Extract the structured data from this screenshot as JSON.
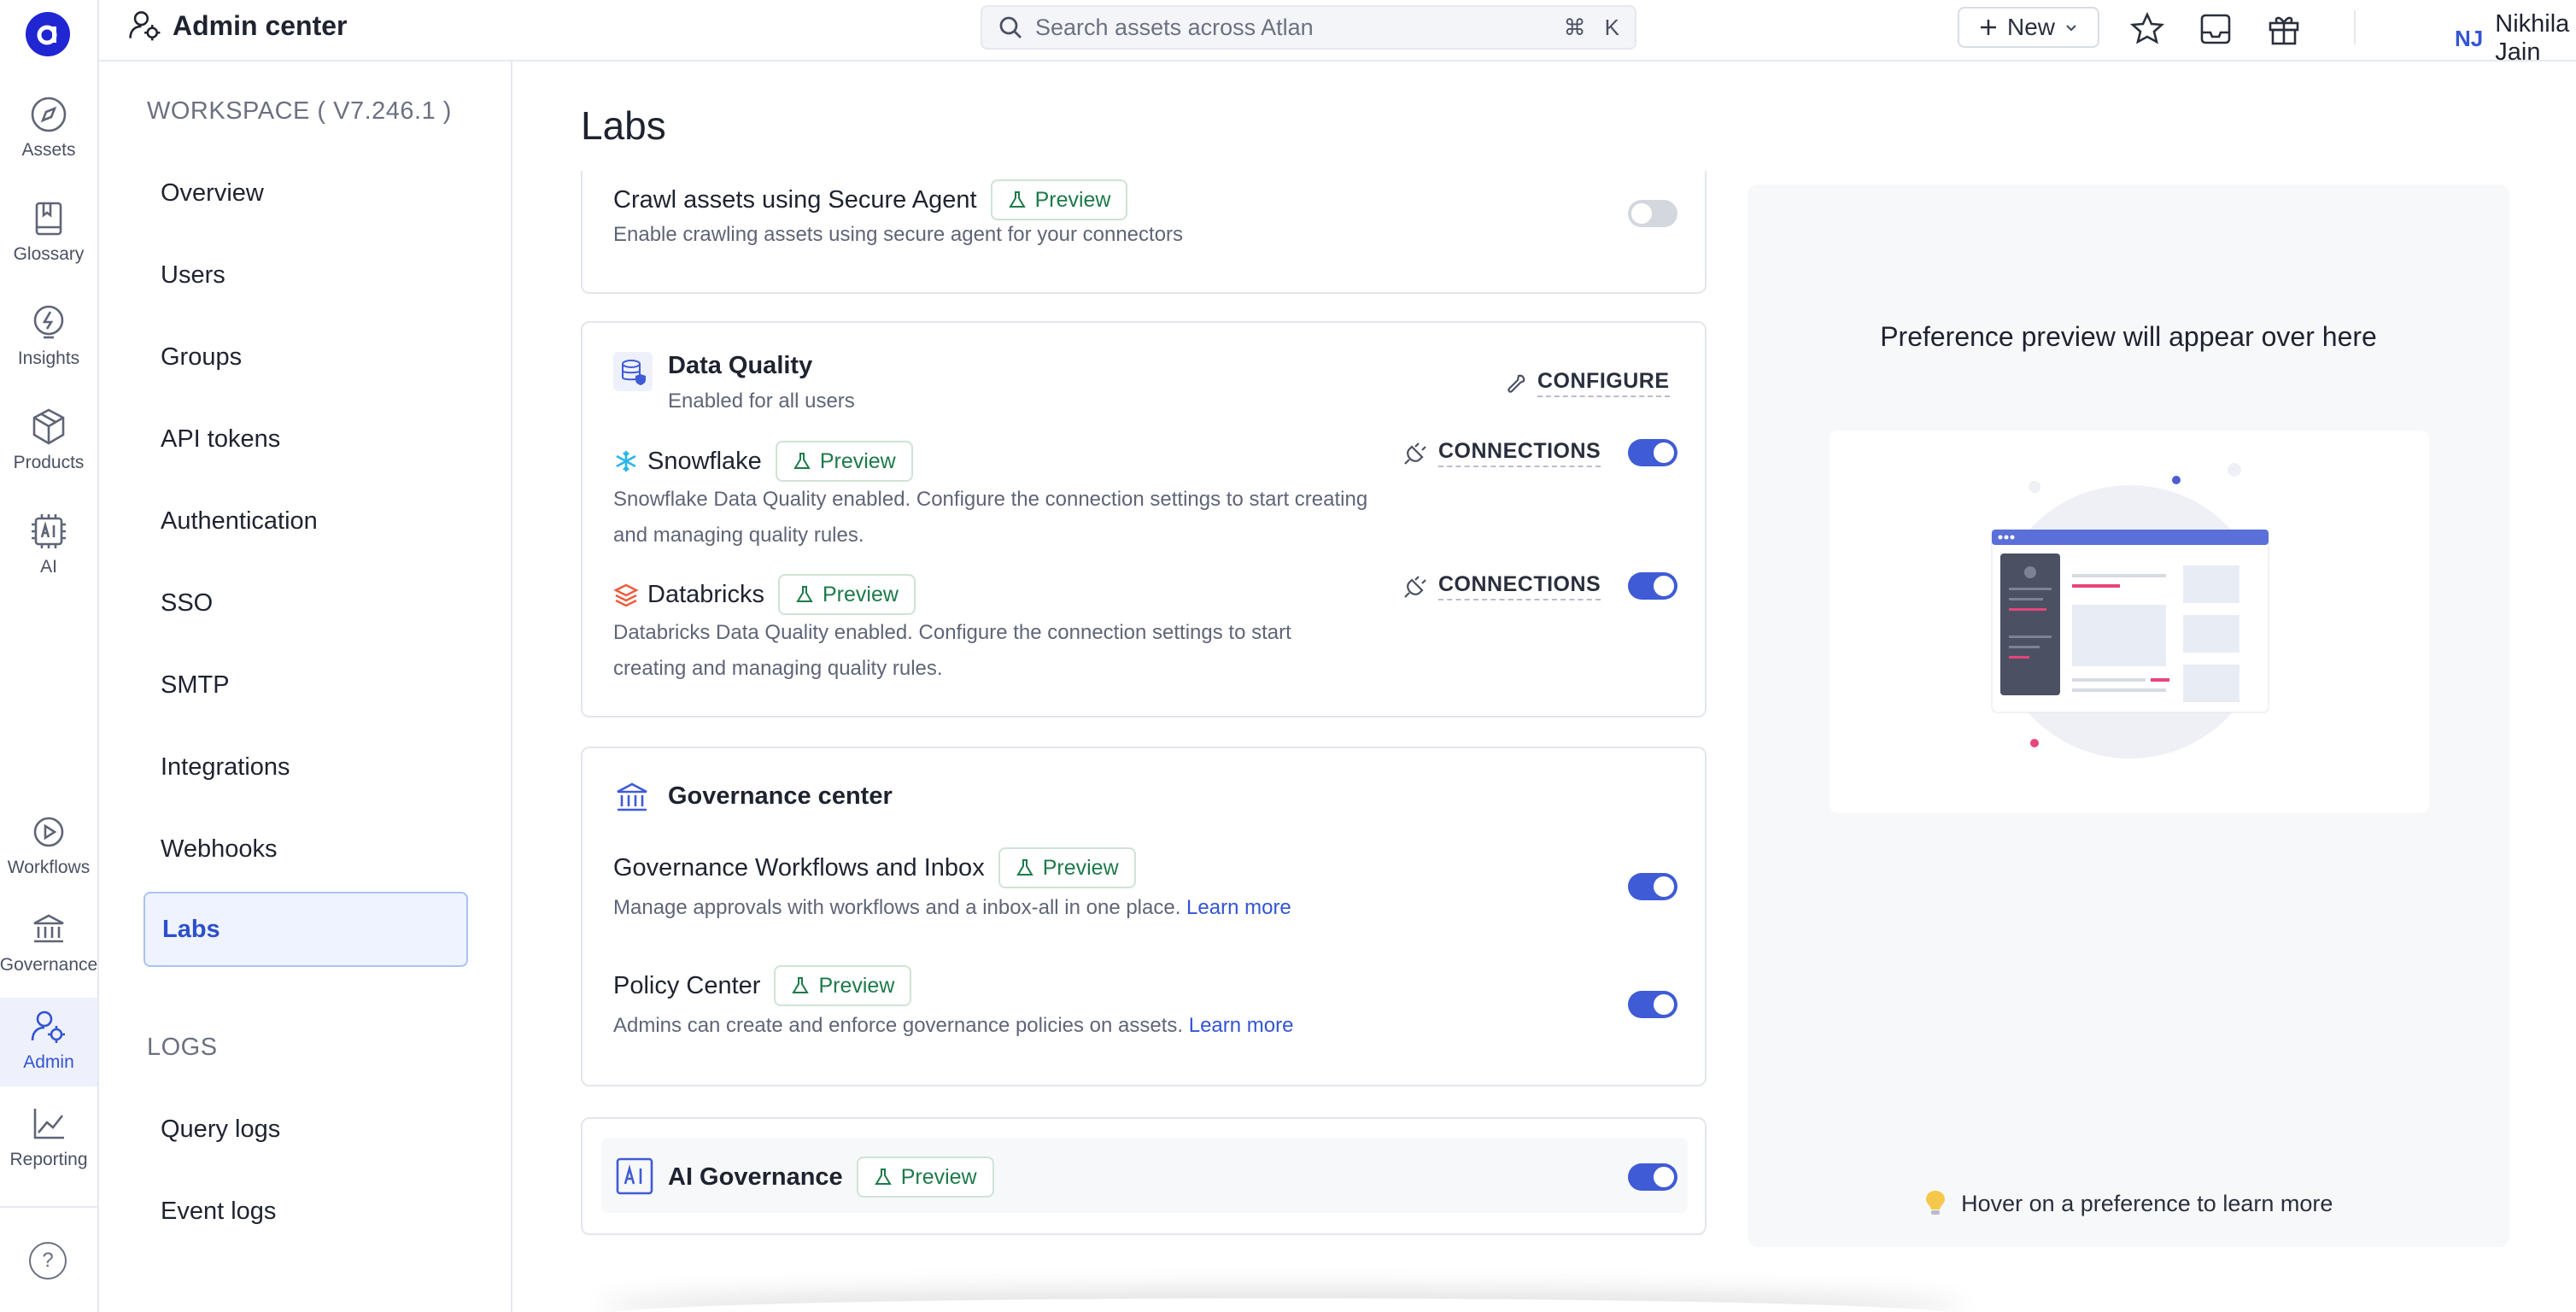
{
  "header": {
    "title": "Admin center",
    "search_placeholder": "Search assets across Atlan",
    "shortcut_cmd": "⌘",
    "shortcut_key": "K",
    "new_label": "New",
    "user_initials": "NJ",
    "user_name": "Nikhila Jain"
  },
  "rail": {
    "items": [
      {
        "label": "Assets"
      },
      {
        "label": "Glossary"
      },
      {
        "label": "Insights"
      },
      {
        "label": "Products"
      },
      {
        "label": "AI"
      },
      {
        "label": "Workflows"
      },
      {
        "label": "Governance"
      },
      {
        "label": "Admin"
      },
      {
        "label": "Reporting"
      }
    ],
    "help": "?"
  },
  "nav": {
    "workspace_heading": "WORKSPACE ( V7.246.1 )",
    "workspace_items": [
      "Overview",
      "Users",
      "Groups",
      "API tokens",
      "Authentication",
      "SSO",
      "SMTP",
      "Integrations",
      "Webhooks",
      "Labs"
    ],
    "logs_heading": "LOGS",
    "logs_items": [
      "Query logs",
      "Event logs"
    ]
  },
  "main": {
    "title": "Labs",
    "preview_badge": "Preview",
    "secure_agent": {
      "title": "Crawl assets using Secure Agent",
      "desc": "Enable crawling assets using secure agent for your connectors",
      "enabled": false
    },
    "data_quality": {
      "title": "Data Quality",
      "subtitle": "Enabled for all users",
      "configure": "CONFIGURE",
      "connections": "CONNECTIONS",
      "snowflake": {
        "title": "Snowflake",
        "desc_line1": "Snowflake Data Quality enabled. Configure the connection settings to start creating",
        "desc_line2": "and managing quality rules.",
        "enabled": true
      },
      "databricks": {
        "title": "Databricks",
        "desc_line1": "Databricks Data Quality enabled. Configure the connection settings to start",
        "desc_line2": "creating and managing quality rules.",
        "enabled": true
      }
    },
    "governance": {
      "title": "Governance center",
      "learn_more": "Learn more",
      "workflows": {
        "title": "Governance Workflows and Inbox",
        "desc": "Manage approvals with workflows and a inbox-all in one place.",
        "enabled": true
      },
      "policy": {
        "title": "Policy Center",
        "desc": "Admins can create and enforce governance policies on assets.",
        "enabled": true
      }
    },
    "ai_governance": {
      "title": "AI Governance",
      "enabled": true
    }
  },
  "preview_panel": {
    "title": "Preference preview will appear over here",
    "hint": "Hover on a preference to learn more"
  },
  "colors": {
    "brand": "#2026d2",
    "accent": "#3f5bd6",
    "preview_green": "#1d7a4a"
  }
}
